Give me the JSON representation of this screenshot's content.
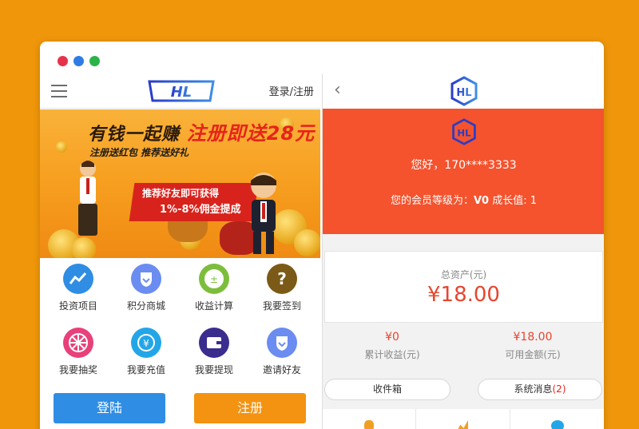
{
  "window": {
    "controls": [
      "close",
      "minimize",
      "maximize"
    ]
  },
  "left_app": {
    "header": {
      "menu_icon": "hamburger-icon",
      "logo": "HL",
      "login_register": "登录/注册"
    },
    "banner": {
      "headline_part1": "有钱一起赚",
      "headline_part2": "注册即送28元",
      "subline": "注册送红包 推荐送好礼",
      "promo_line1": "推荐好友即可获得",
      "promo_line2": "1%-8%佣金提成"
    },
    "features": [
      {
        "label": "投资项目",
        "icon": "chart-line-icon",
        "color": "#2f8de4"
      },
      {
        "label": "积分商城",
        "icon": "shield-badge-icon",
        "color": "#6b8cf0"
      },
      {
        "label": "收益计算",
        "icon": "calculator-icon",
        "color": "#7dbd3c"
      },
      {
        "label": "我要签到",
        "icon": "question-icon",
        "color": "#7a5a16"
      },
      {
        "label": "我要抽奖",
        "icon": "prize-wheel-icon",
        "color": "#e8407a"
      },
      {
        "label": "我要充值",
        "icon": "yen-coin-icon",
        "color": "#22a6e8"
      },
      {
        "label": "我要提现",
        "icon": "wallet-icon",
        "color": "#3a2d8e"
      },
      {
        "label": "邀请好友",
        "icon": "shield-badge-icon",
        "color": "#6b8cf0"
      }
    ],
    "buttons": {
      "login": "登陆",
      "register": "注册"
    }
  },
  "right_app": {
    "header": {
      "back_icon": "chevron-left-icon",
      "logo": "HL"
    },
    "profile": {
      "logo": "HL",
      "greeting": "您好，170****3333",
      "level_prefix": "您的会员等级为：",
      "level_value": "V0",
      "growth_label": "成长值:",
      "growth_value": "1"
    },
    "assets": {
      "title": "总资产(元)",
      "value": "¥18.00"
    },
    "stats": [
      {
        "value": "¥0",
        "label": "累计收益(元)"
      },
      {
        "value": "¥18.00",
        "label": "可用金额(元)"
      }
    ],
    "tabs": {
      "inbox": "收件箱",
      "system_messages": "系统消息",
      "system_count": "(2)"
    },
    "accent_color": "#f4532e"
  }
}
